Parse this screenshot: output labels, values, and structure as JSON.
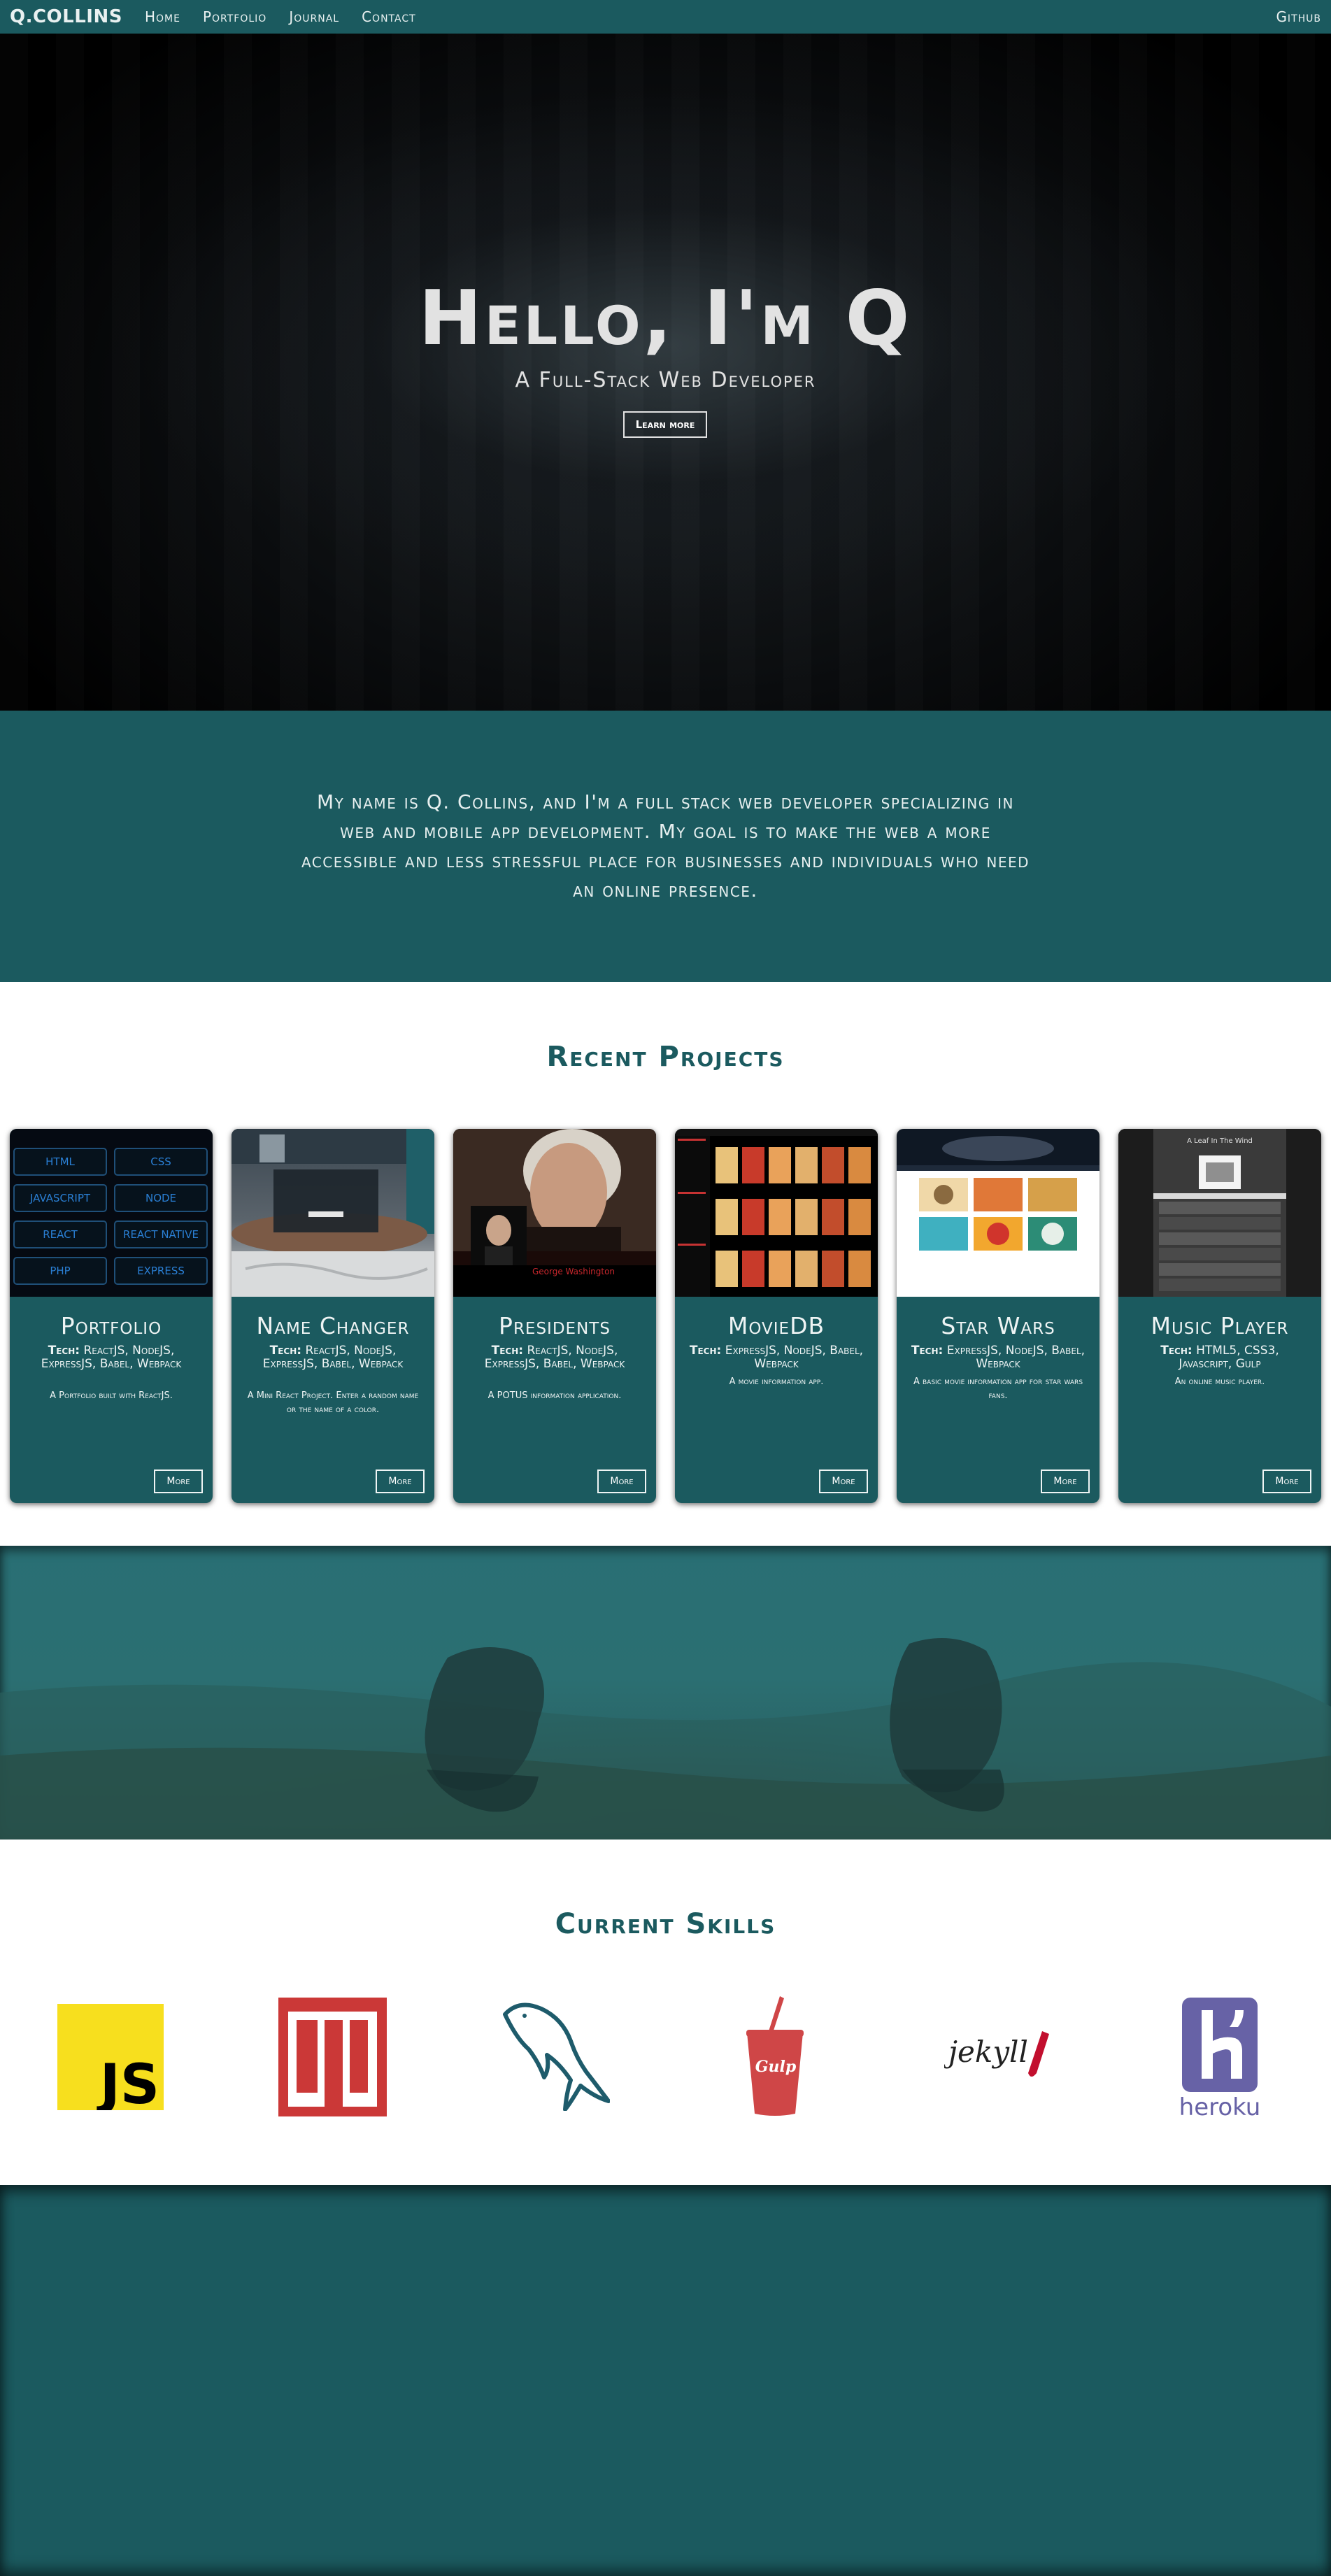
{
  "nav": {
    "brand": "Q.COLLINS",
    "links": [
      "Home",
      "Portfolio",
      "Journal",
      "Contact"
    ],
    "right_link": "Github"
  },
  "hero": {
    "title": "Hello, I'm Q",
    "subtitle": "A Full-Stack Web Developer",
    "button": "Learn more"
  },
  "about": {
    "text": "My name is Q. Collins, and I'm a full stack web developer specializing in web and mobile app development. My goal is to make the web a more accessible and less stressful place for businesses and individuals who need an online presence."
  },
  "projects": {
    "heading": "Recent Projects",
    "tech_label": "Tech:",
    "items": [
      {
        "title": "Portfolio",
        "tech": "ReactJS, NodeJS, ExpressJS, Babel, Webpack",
        "desc": "A Portfolio built with ReactJS.",
        "button": "More",
        "thumb_labels": [
          "HTML",
          "CSS",
          "JAVASCRIPT",
          "NODE",
          "REACT",
          "REACT NATIVE",
          "PHP",
          "EXPRESS"
        ]
      },
      {
        "title": "Name Changer",
        "tech": "ReactJS, NodeJS, ExpressJS, Babel, Webpack",
        "desc": "A Mini React Project. Enter a random name or the name of a color.",
        "button": "More"
      },
      {
        "title": "Presidents",
        "tech": "ReactJS, NodeJS, ExpressJS, Babel, Webpack",
        "desc": "A POTUS information application.",
        "button": "More",
        "thumb_caption": "George Washington"
      },
      {
        "title": "MovieDB",
        "tech": "ExpressJS, NodeJS, Babel, Webpack",
        "desc": "A movie information app.",
        "button": "More"
      },
      {
        "title": "Star Wars",
        "tech": "ExpressJS, NodeJS, Babel, Webpack",
        "desc": "A basic movie information app for star wars fans.",
        "button": "More"
      },
      {
        "title": "Music Player",
        "tech": "HTML5, CSS3, Javascript, Gulp",
        "desc": "An online music player.",
        "button": "More",
        "thumb_title": "A Leaf In The Wind"
      }
    ]
  },
  "skills": {
    "heading": "Current Skills",
    "js_label": "JS",
    "npm_label": "npm",
    "gulp_label": "Gulp",
    "jekyll_label": "jekyll",
    "heroku_label": "heroku"
  },
  "colors": {
    "primary": "#1b5a5f",
    "js_yellow": "#f7df1e",
    "npm_red": "#cb3837",
    "gulp_red": "#cf4647",
    "heroku_purple": "#6762a6",
    "mysql_teal": "#1e5b6b"
  }
}
